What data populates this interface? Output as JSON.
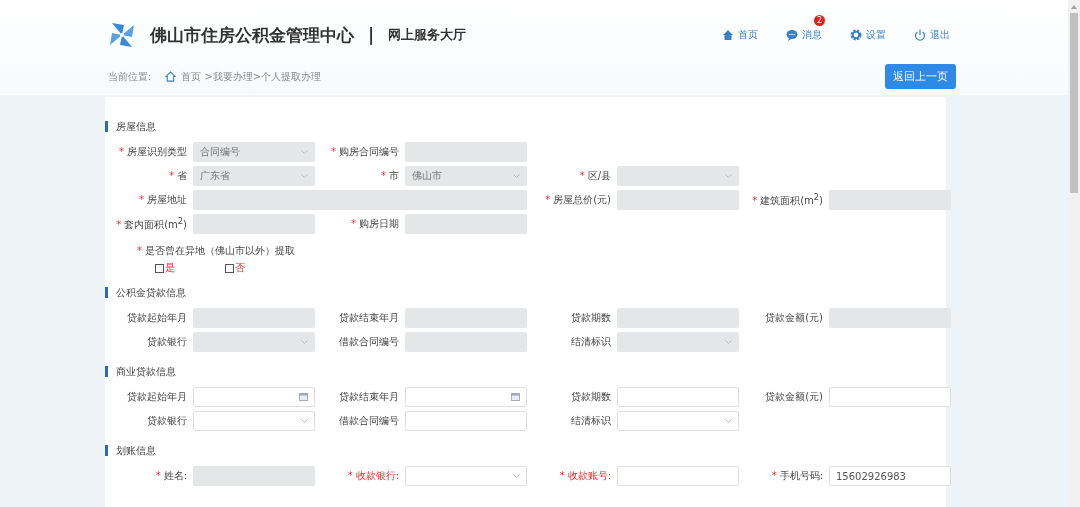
{
  "header": {
    "title": "佛山市住房公积金管理中心",
    "separator": "|",
    "subtitle": "网上服务大厅",
    "nav": [
      {
        "kind": "home",
        "label": "首页"
      },
      {
        "kind": "message",
        "label": "消息",
        "badge": "2"
      },
      {
        "kind": "settings",
        "label": "设置"
      },
      {
        "kind": "logout",
        "label": "退出"
      }
    ]
  },
  "breadcrumb": {
    "prefix": "当前位置:",
    "home": "首页",
    "path": ">我要办理>个人提取办理"
  },
  "back_button": "返回上一页",
  "sections": [
    {
      "title": "房屋信息",
      "rows": [
        [
          {
            "asterisk": "*",
            "label": "房屋识别类型",
            "kind": "select",
            "disabled": true,
            "value": "合同编号"
          },
          {
            "asterisk": "*",
            "label": "购房合同编号",
            "kind": "text",
            "disabled": true
          }
        ],
        [
          {
            "asterisk": "*",
            "label": "省",
            "kind": "select",
            "disabled": true,
            "value": "广东省"
          },
          {
            "asterisk": "*",
            "label": "市",
            "kind": "select",
            "disabled": true,
            "value": "佛山市"
          },
          {
            "asterisk": "*",
            "label": "区/县",
            "kind": "select",
            "disabled": true
          }
        ],
        [
          {
            "asterisk": "*",
            "label": "房屋地址",
            "kind": "text",
            "disabled": true,
            "colspan": 2
          },
          {
            "asterisk": "*",
            "label": "房屋总价(元)",
            "kind": "text",
            "disabled": true
          },
          {
            "asterisk": "*",
            "label": "建筑面积(m$^{2}$)",
            "kind": "text",
            "disabled": true
          }
        ],
        [
          {
            "asterisk": "*",
            "label": "套内面积(m$^{2}$)",
            "kind": "text",
            "disabled": true
          },
          {
            "asterisk": "*",
            "label": "购房日期",
            "kind": "text",
            "disabled": true
          }
        ]
      ],
      "question": {
        "asterisk": "*",
        "label": "是否曾在异地（佛山市以外）提取",
        "options": [
          {
            "label": "是",
            "checked": false
          },
          {
            "label": "否",
            "checked": false
          }
        ]
      }
    },
    {
      "title": "公积金贷款信息",
      "rows": [
        [
          {
            "label": "贷款起始年月",
            "kind": "text",
            "disabled": true
          },
          {
            "label": "贷款结束年月",
            "kind": "text",
            "disabled": true
          },
          {
            "label": "贷款期数",
            "kind": "text",
            "disabled": true
          },
          {
            "label": "贷款金额(元)",
            "kind": "text",
            "disabled": true
          }
        ],
        [
          {
            "label": "贷款银行",
            "kind": "select",
            "disabled": true
          },
          {
            "label": "借款合同编号",
            "kind": "text",
            "disabled": true
          },
          {
            "label": "结清标识",
            "kind": "select",
            "disabled": true
          }
        ]
      ]
    },
    {
      "title": "商业贷款信息",
      "rows": [
        [
          {
            "label": "贷款起始年月",
            "kind": "date",
            "disabled": false
          },
          {
            "label": "贷款结束年月",
            "kind": "date",
            "disabled": false
          },
          {
            "label": "贷款期数",
            "kind": "text",
            "disabled": false
          },
          {
            "label": "贷款金额(元)",
            "kind": "text",
            "disabled": false
          }
        ],
        [
          {
            "label": "贷款银行",
            "kind": "select",
            "disabled": false
          },
          {
            "label": "借款合同编号",
            "kind": "text",
            "disabled": false
          },
          {
            "label": "结清标识",
            "kind": "select",
            "disabled": false
          }
        ]
      ]
    },
    {
      "title": "划账信息",
      "rows": [
        [
          {
            "asterisk": "*",
            "label": "姓名:",
            "kind": "text",
            "disabled": true
          },
          {
            "asterisk": "*",
            "label": "收款银行:",
            "alert": true,
            "kind": "select",
            "disabled": false
          },
          {
            "asterisk": "*",
            "label": "收款账号:",
            "alert": true,
            "kind": "text",
            "disabled": false
          },
          {
            "asterisk": "*",
            "label": "手机号码:",
            "kind": "text",
            "disabled": false,
            "value": "15602926983"
          }
        ]
      ]
    }
  ]
}
